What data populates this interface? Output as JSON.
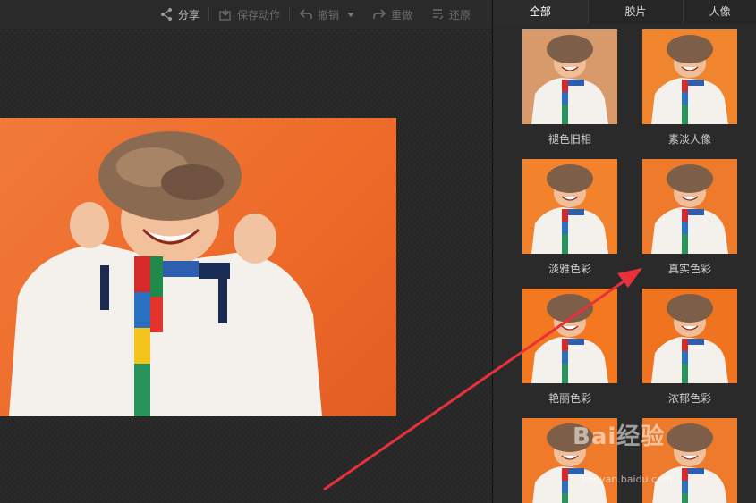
{
  "toolbar": {
    "share_label": "分享",
    "save_action_label": "保存动作",
    "undo_label": "撤销",
    "redo_label": "重做",
    "restore_label": "还原"
  },
  "tabs": [
    {
      "label": "全部",
      "active": true
    },
    {
      "label": "胶片",
      "active": false
    },
    {
      "label": "人像",
      "active": false
    }
  ],
  "effects": [
    {
      "label": "褪色旧相",
      "tint": "#d89a6a"
    },
    {
      "label": "素淡人像",
      "tint": "#f0852e"
    },
    {
      "label": "淡雅色彩",
      "tint": "#f2822c"
    },
    {
      "label": "真实色彩",
      "tint": "#ee7a2c"
    },
    {
      "label": "艳丽色彩",
      "tint": "#f3781f"
    },
    {
      "label": "浓郁色彩",
      "tint": "#f07320"
    },
    {
      "label": "",
      "tint": "#ef7a2a"
    },
    {
      "label": "",
      "tint": "#ee7a2c"
    }
  ],
  "watermark": {
    "brand": "Bai经验",
    "url": "jingyan.baidu.com"
  },
  "colors": {
    "photo_bg": "#ee6b2a",
    "annotation_arrow": "#e8313a"
  }
}
